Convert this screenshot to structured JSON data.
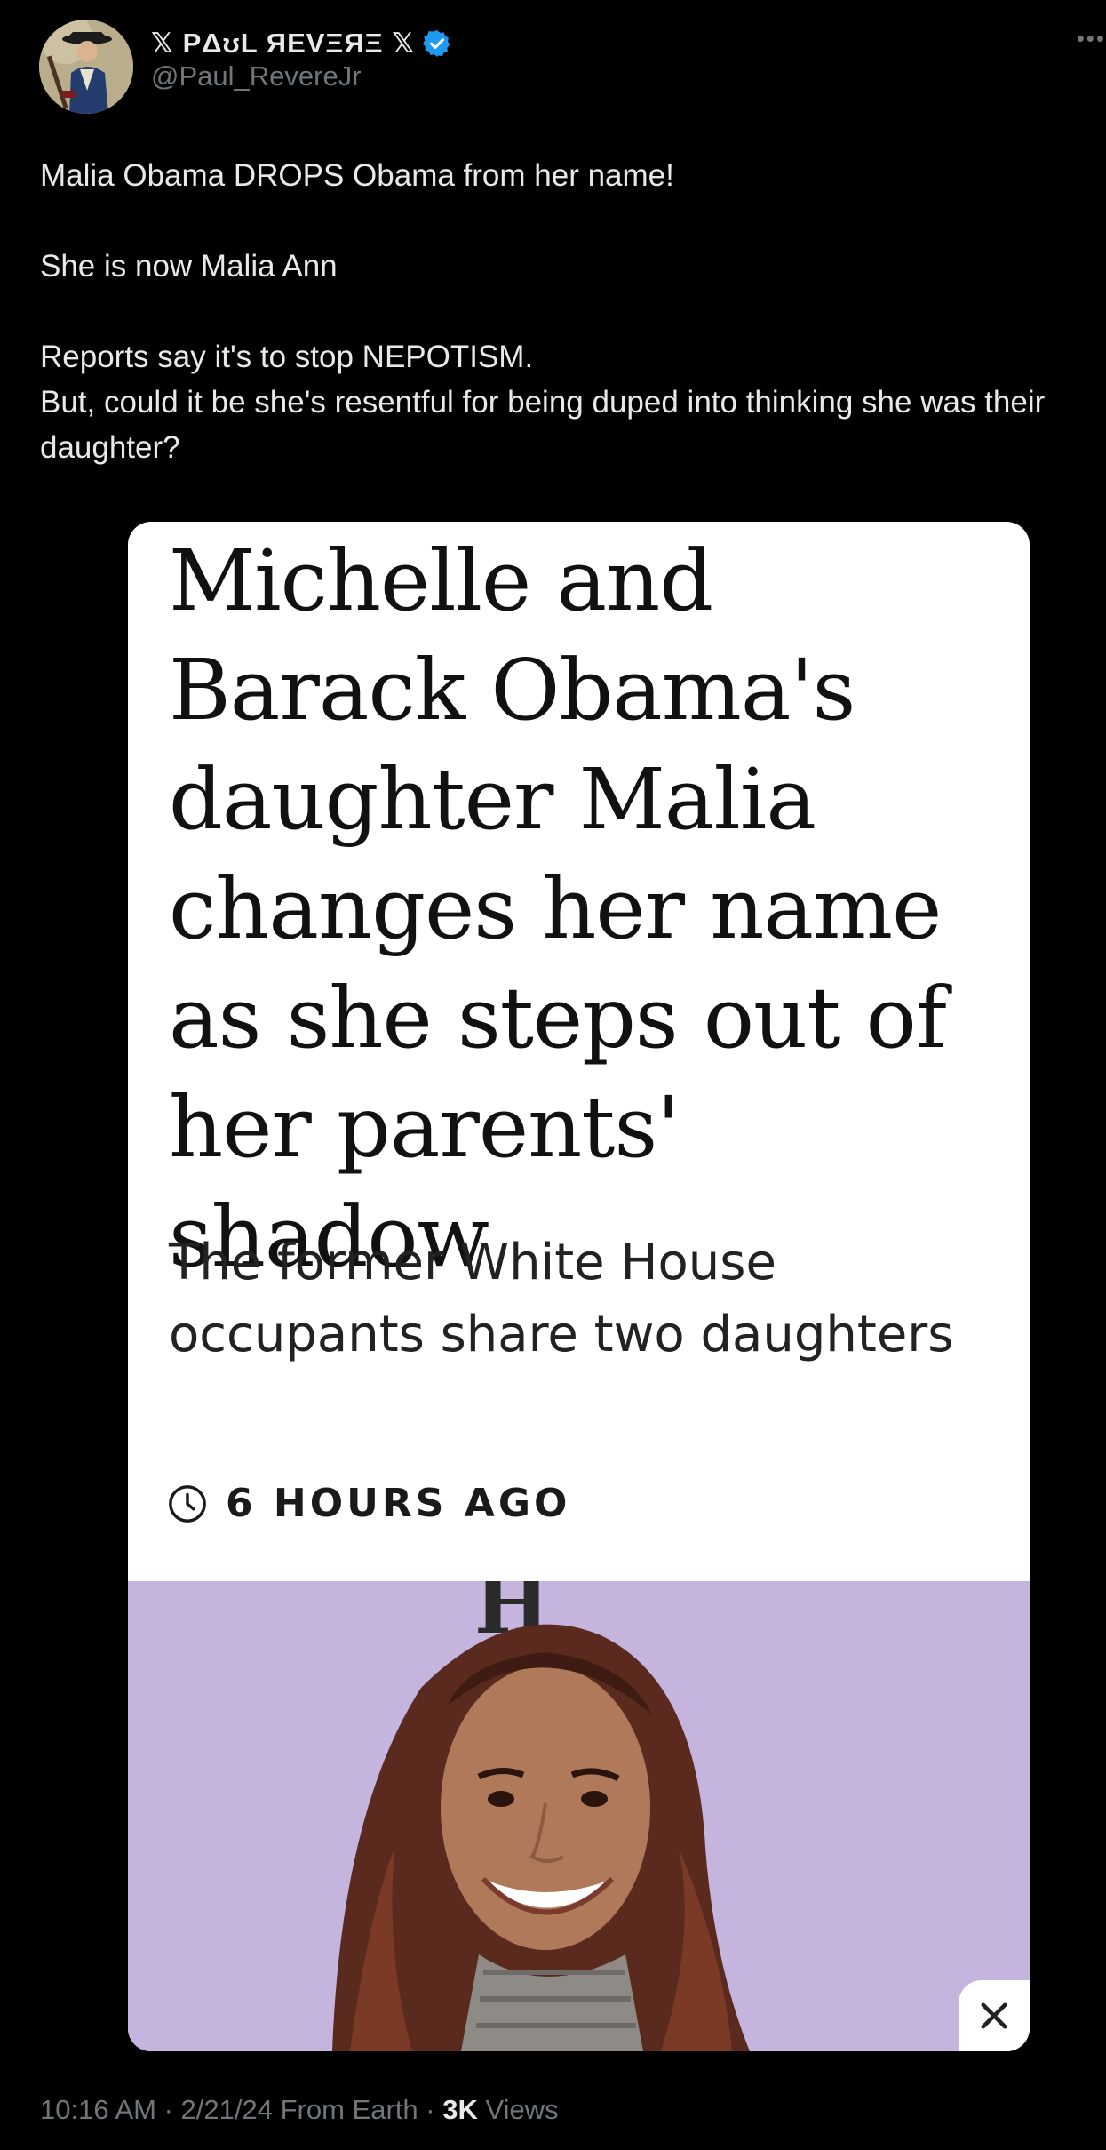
{
  "author": {
    "display_name": "𝕏 PΔʊL ЯEVΞЯΞ 𝕏",
    "handle": "@Paul_RevereJr",
    "verified_color": "#1d9bf0",
    "avatar_icon": "colonial-soldier-avatar"
  },
  "tweet": {
    "lines": [
      "Malia Obama DROPS Obama from her name!",
      "She is now Malia Ann",
      "Reports say it's to stop NEPOTISM.",
      "But, could it be she's resentful for being duped into thinking she was their daughter?"
    ]
  },
  "card": {
    "headline": "Michelle and Barack Obama's daughter Malia changes her name as she steps out of her parents' shadow",
    "subhead": "The former White House occupants share two daughters",
    "time_ago": "6 HOURS AGO",
    "photo_backdrop_text": "H",
    "clock_icon": "clock-icon",
    "close_icon": "close-icon"
  },
  "meta": {
    "time": "10:16 AM",
    "separator": " · ",
    "date": "2/21/24",
    "source": "From Earth",
    "views_count": "3K",
    "views_label": "Views"
  },
  "colors": {
    "background": "#000000",
    "text_primary": "#e7e9ea",
    "text_secondary": "#71767b",
    "photo_bg": "#c8b8e6"
  }
}
